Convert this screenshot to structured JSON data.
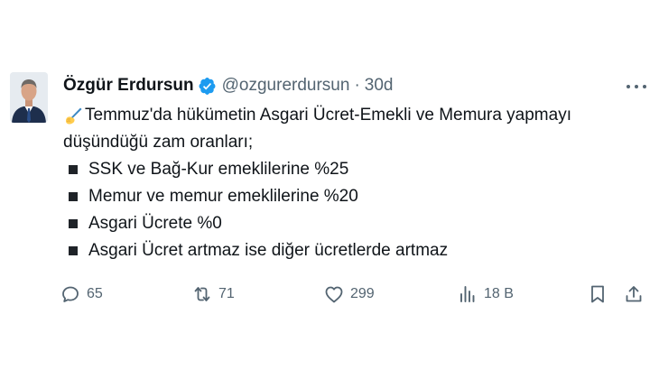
{
  "author": {
    "name": "Özgür Erdursun",
    "handle": "@ozgurerdursun",
    "separator": "·",
    "time": "30d"
  },
  "tweet": {
    "intro_line1": "Temmuz'da hükümetin Asgari Ücret-Emekli ve Memura yapmayı",
    "intro_line2": "düşündüğü zam oranları;",
    "bullets": [
      "SSK ve Bağ-Kur emeklilerine %25",
      "Memur ve memur emeklilerine %20",
      "Asgari Ücrete %0",
      "Asgari Ücret artmaz ise diğer ücretlerde artmaz"
    ]
  },
  "actions": {
    "replies": "65",
    "retweets": "71",
    "likes": "299",
    "views": "18 B"
  },
  "icons": {
    "verified": "verified-badge-icon",
    "more": "more-icon",
    "reply": "reply-icon",
    "retweet": "retweet-icon",
    "like": "heart-icon",
    "views": "views-icon",
    "bookmark": "bookmark-icon",
    "share": "share-icon",
    "writing_hand": "writing-hand-icon"
  },
  "colors": {
    "text": "#0f1419",
    "secondary": "#536471",
    "verified": "#1d9bf0"
  }
}
